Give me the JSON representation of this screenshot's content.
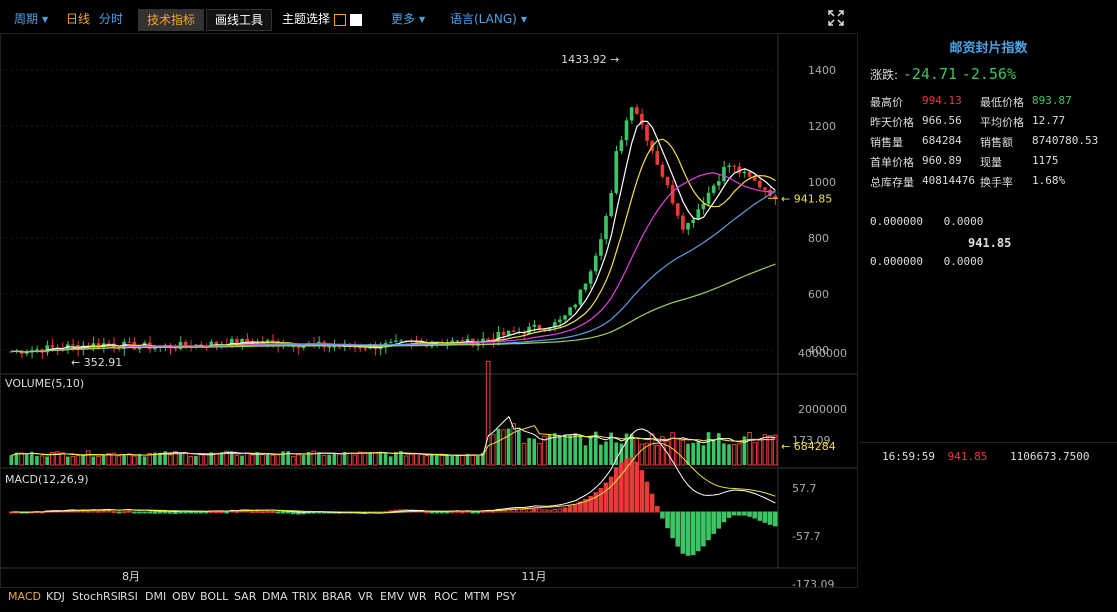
{
  "toolbar": {
    "period_label": "周期",
    "day_line": "日线",
    "minute_line": "分时",
    "tech_indicator": "技术指标",
    "draw_tools": "画线工具",
    "theme_select": "主题选择",
    "more": "更多",
    "language": "语言(LANG)"
  },
  "main_chart": {
    "high_marker": "1433.92",
    "low_marker": "352.91",
    "last_price_tag": "941.85",
    "y_ticks": [
      "1400",
      "1200",
      "1000",
      "800",
      "600",
      "400"
    ]
  },
  "volume": {
    "label": "VOLUME(5,10)",
    "y_ticks": [
      "4000000",
      "2000000"
    ],
    "last_tag": "684284"
  },
  "macd": {
    "label": "MACD(12,26,9)",
    "y_ticks": [
      "173.09",
      "57.7",
      "-57.7",
      "-173.09"
    ]
  },
  "x_axis": {
    "labels": [
      "8月",
      "11月"
    ]
  },
  "indicators": [
    "MACD",
    "KDJ",
    "StochRSI",
    "RSI",
    "DMI",
    "OBV",
    "BOLL",
    "SAR",
    "DMA",
    "TRIX",
    "BRAR",
    "VR",
    "EMV",
    "WR",
    "ROC",
    "MTM",
    "PSY"
  ],
  "side": {
    "title": "邮资封片指数",
    "change_label": "涨跌:",
    "change_value": "-24.71",
    "change_pct": "-2.56%",
    "rows": [
      {
        "l1": "最高价",
        "v1": "994.13",
        "l2": "最低价格",
        "v2": "893.87"
      },
      {
        "l1": "昨天价格",
        "v1": "966.56",
        "l2": "平均价格",
        "v2": "12.77"
      },
      {
        "l1": "销售量",
        "v1": "684284",
        "l2": "销售额",
        "v2": "8740780.53"
      },
      {
        "l1": "首单价格",
        "v1": "960.89",
        "l2": "现量",
        "v2": "1175"
      },
      {
        "l1": "总库存量",
        "v1": "40814476",
        "l2": "换手率",
        "v2": "1.68%"
      }
    ],
    "book_top": {
      "price": "0.000000",
      "qty": "0.0000"
    },
    "book_mid": "941.85",
    "book_bottom": {
      "price": "0.000000",
      "qty": "0.0000"
    },
    "trade": {
      "time": "16:59:59",
      "price": "941.85",
      "amount": "1106673.7500"
    }
  },
  "colors": {
    "up": "#e83a3a",
    "down": "#3cc465",
    "accent": "#f5a623",
    "title_blue": "#4aa3e8"
  },
  "chart_data": [
    {
      "type": "line",
      "name": "price",
      "x": [
        "8月",
        "11月"
      ],
      "close_approx": [
        400,
        410,
        420,
        415,
        425,
        420,
        430,
        425,
        430,
        428,
        430,
        440,
        520,
        700,
        1300,
        1100,
        950,
        1050,
        1000,
        980,
        941.85
      ],
      "ylim": [
        352.91,
        1433.92
      ]
    },
    {
      "type": "bar",
      "name": "volume",
      "ylim": [
        0,
        4000000
      ]
    },
    {
      "type": "bar",
      "name": "macd",
      "ylim": [
        -173.09,
        173.09
      ]
    }
  ]
}
